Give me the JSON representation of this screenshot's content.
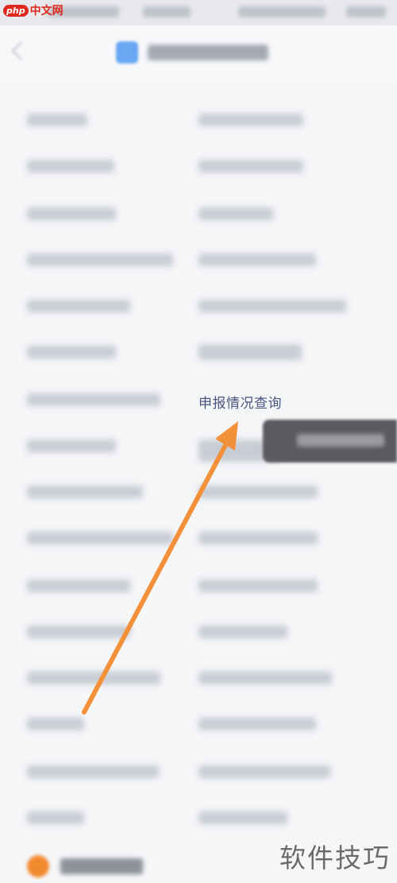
{
  "watermark": {
    "logo_php": "php",
    "logo_cn": "中文网",
    "bottom_right": "软件技巧"
  },
  "highlighted_item": {
    "label": "申报情况查询"
  },
  "colors": {
    "arrow": "#f2913a",
    "focus_text": "#4a5580",
    "tooltip_bg": "#5a5a5f"
  }
}
